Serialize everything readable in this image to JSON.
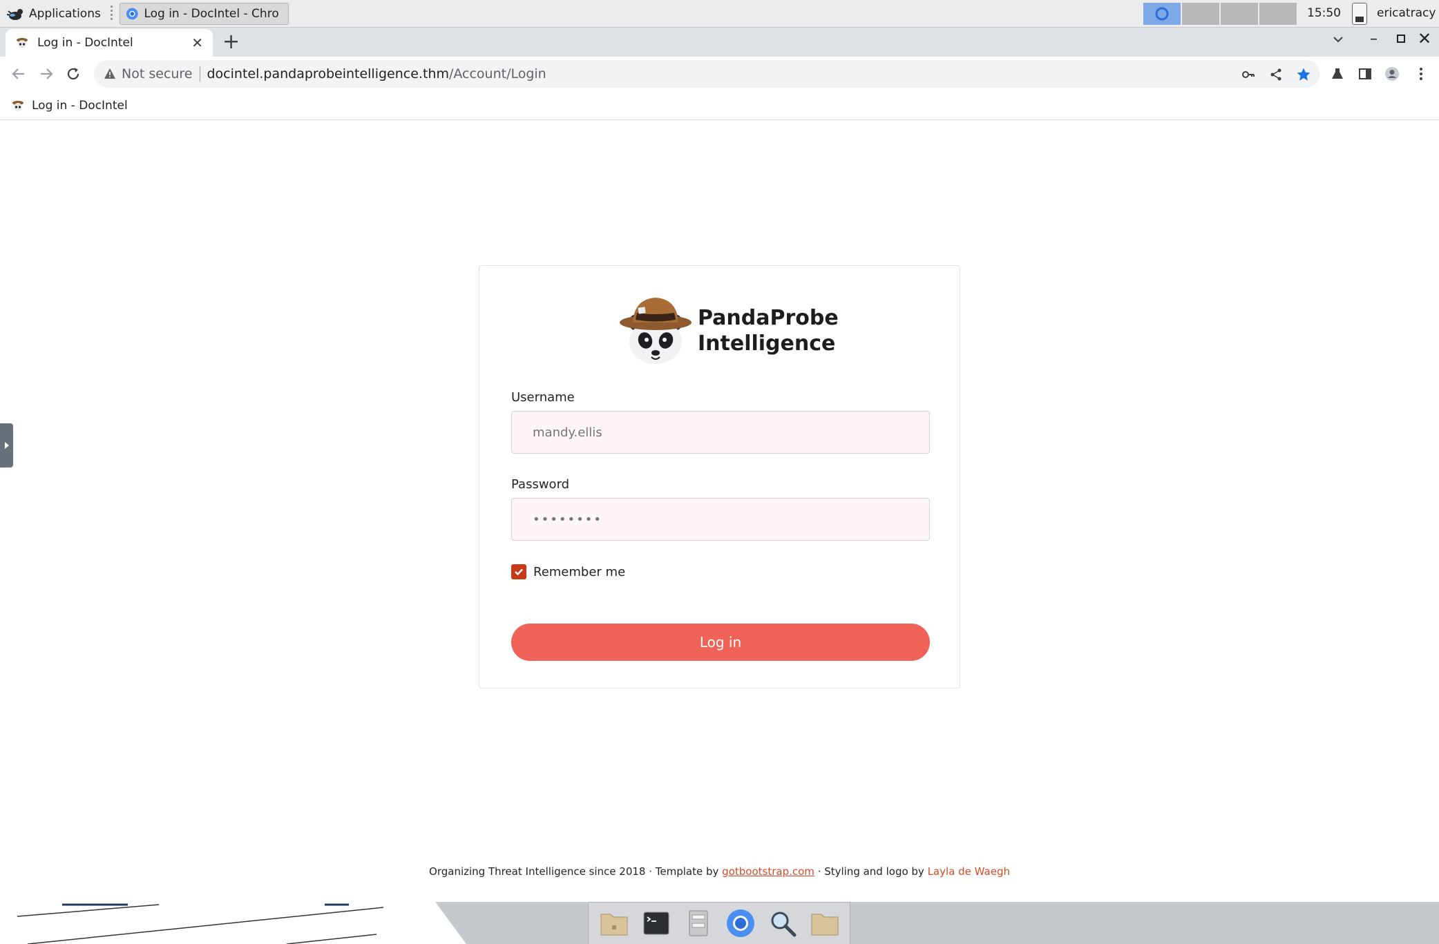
{
  "os_panel": {
    "applications_label": "Applications",
    "task_title": "Log in - DocIntel - Chro...",
    "clock": "15:50",
    "user": "ericatracy"
  },
  "browser": {
    "tab_title": "Log in - DocIntel",
    "security_label": "Not secure",
    "url_host": "docintel.pandaprobeintelligence.thm",
    "url_path": "/Account/Login",
    "bookmark_label": "Log in - DocIntel"
  },
  "login": {
    "logo_line1": "PandaProbe",
    "logo_line2": "Intelligence",
    "username_label": "Username",
    "username_placeholder": "mandy.ellis",
    "password_label": "Password",
    "password_placeholder": "••••••••",
    "remember_label": "Remember me",
    "remember_checked": true,
    "submit_label": "Log in"
  },
  "footer": {
    "text_before": "Organizing Threat Intelligence since 2018 · Template by ",
    "link1": "gotbootstrap.com",
    "text_middle": " · Styling and logo by ",
    "link2": "Layla de Waegh"
  },
  "dock": {
    "items": [
      "home-folder-icon",
      "terminal-icon",
      "file-manager-icon",
      "chromium-icon",
      "search-icon",
      "folder-icon"
    ]
  },
  "colors": {
    "accent": "#ef6358",
    "checkbox": "#c53a18",
    "link": "#d94a26",
    "input_bg": "#fdf5f8"
  }
}
